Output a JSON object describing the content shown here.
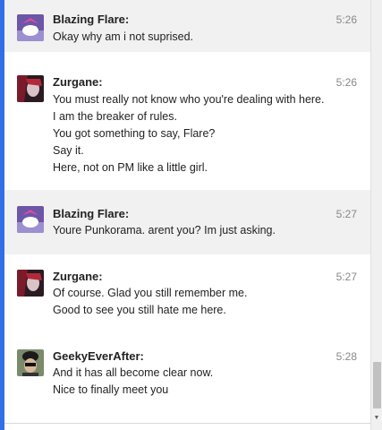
{
  "messages": [
    {
      "sender": "Blazing Flare:",
      "time": "5:26",
      "lines": [
        "Okay why am i not suprised."
      ]
    },
    {
      "sender": "Zurgane:",
      "time": "5:26",
      "lines": [
        "You must really not know who you're dealing with here.",
        "I am the breaker of rules.",
        "You got something to say, Flare?",
        "Say it.",
        "Here, not on PM like a little girl."
      ]
    },
    {
      "sender": "Blazing Flare:",
      "time": "5:27",
      "lines": [
        "Youre Punkorama. arent you? Im just asking."
      ]
    },
    {
      "sender": "Zurgane:",
      "time": "5:27",
      "lines": [
        "Of course. Glad you still remember me.",
        "Good to see you still hate me here."
      ]
    },
    {
      "sender": "GeekyEverAfter:",
      "time": "5:28",
      "lines": [
        "And it has all become clear now.",
        "Nice to finally meet you"
      ]
    }
  ],
  "colors": {
    "accent": "#2f6fe8",
    "shaded_bg": "#f1f1f1"
  },
  "icons": {
    "scroll_down": "triangle-down-icon"
  }
}
